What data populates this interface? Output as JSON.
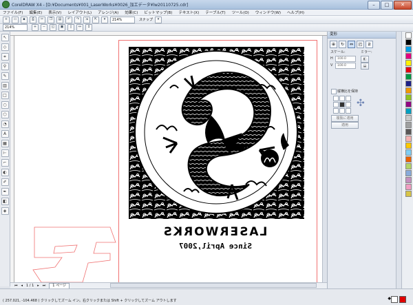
{
  "window": {
    "title": "CorelDRAW X4 - [D:¥Documents¥001_LaserWorks¥0026_加工データ¥lw20110725.cdr]",
    "minimize": "–",
    "maximize": "□",
    "close": "✕"
  },
  "menu": [
    "ファイル(F)",
    "編集(E)",
    "表示(V)",
    "レイアウト(L)",
    "アレンジ(A)",
    "効果(C)",
    "ビットマップ(B)",
    "テキスト(X)",
    "テーブル(T)",
    "ツール(O)",
    "ウィンドウ(W)",
    "ヘルプ(H)"
  ],
  "toolbar": {
    "zoom_value": "214%",
    "snap_label": "スナップ"
  },
  "property_bar": {
    "zoom_value": "214%"
  },
  "document": {
    "main_text": "LASERWORKS",
    "sub_text": "Since April,2007"
  },
  "page_nav": {
    "counter": "1 / 1",
    "page_tab": "1 ページ"
  },
  "docker": {
    "title": "変形",
    "scale_label": "スケール:",
    "mirror_label": "ミラー:",
    "scale_h": "100.0",
    "scale_v": "100.0",
    "aspect_label": "縦横比を保持",
    "apply_copy": "複製に適用",
    "apply": "適用"
  },
  "status": {
    "text": "( 257.021, -104.468 )    クリックしてズーム イン。右クリックまたは Shift + クリックしてズーム アウトします"
  },
  "palette_colors": [
    "#ffffff",
    "#000000",
    "#00a0e9",
    "#e4007f",
    "#fff100",
    "#e60012",
    "#009944",
    "#1d2088",
    "#f39800",
    "#8fc31f",
    "#920783",
    "#00a0c1",
    "#c9caca",
    "#9fa0a0",
    "#595757",
    "#f5b2b2",
    "#fcc800",
    "#7ecef4",
    "#eb6100",
    "#b3d465",
    "#88abda",
    "#c490bf",
    "#f19ec2",
    "#d7c447"
  ],
  "colors": {
    "fill": "#e00000",
    "outline": "#ffffff",
    "cut_line": "#f07070"
  }
}
